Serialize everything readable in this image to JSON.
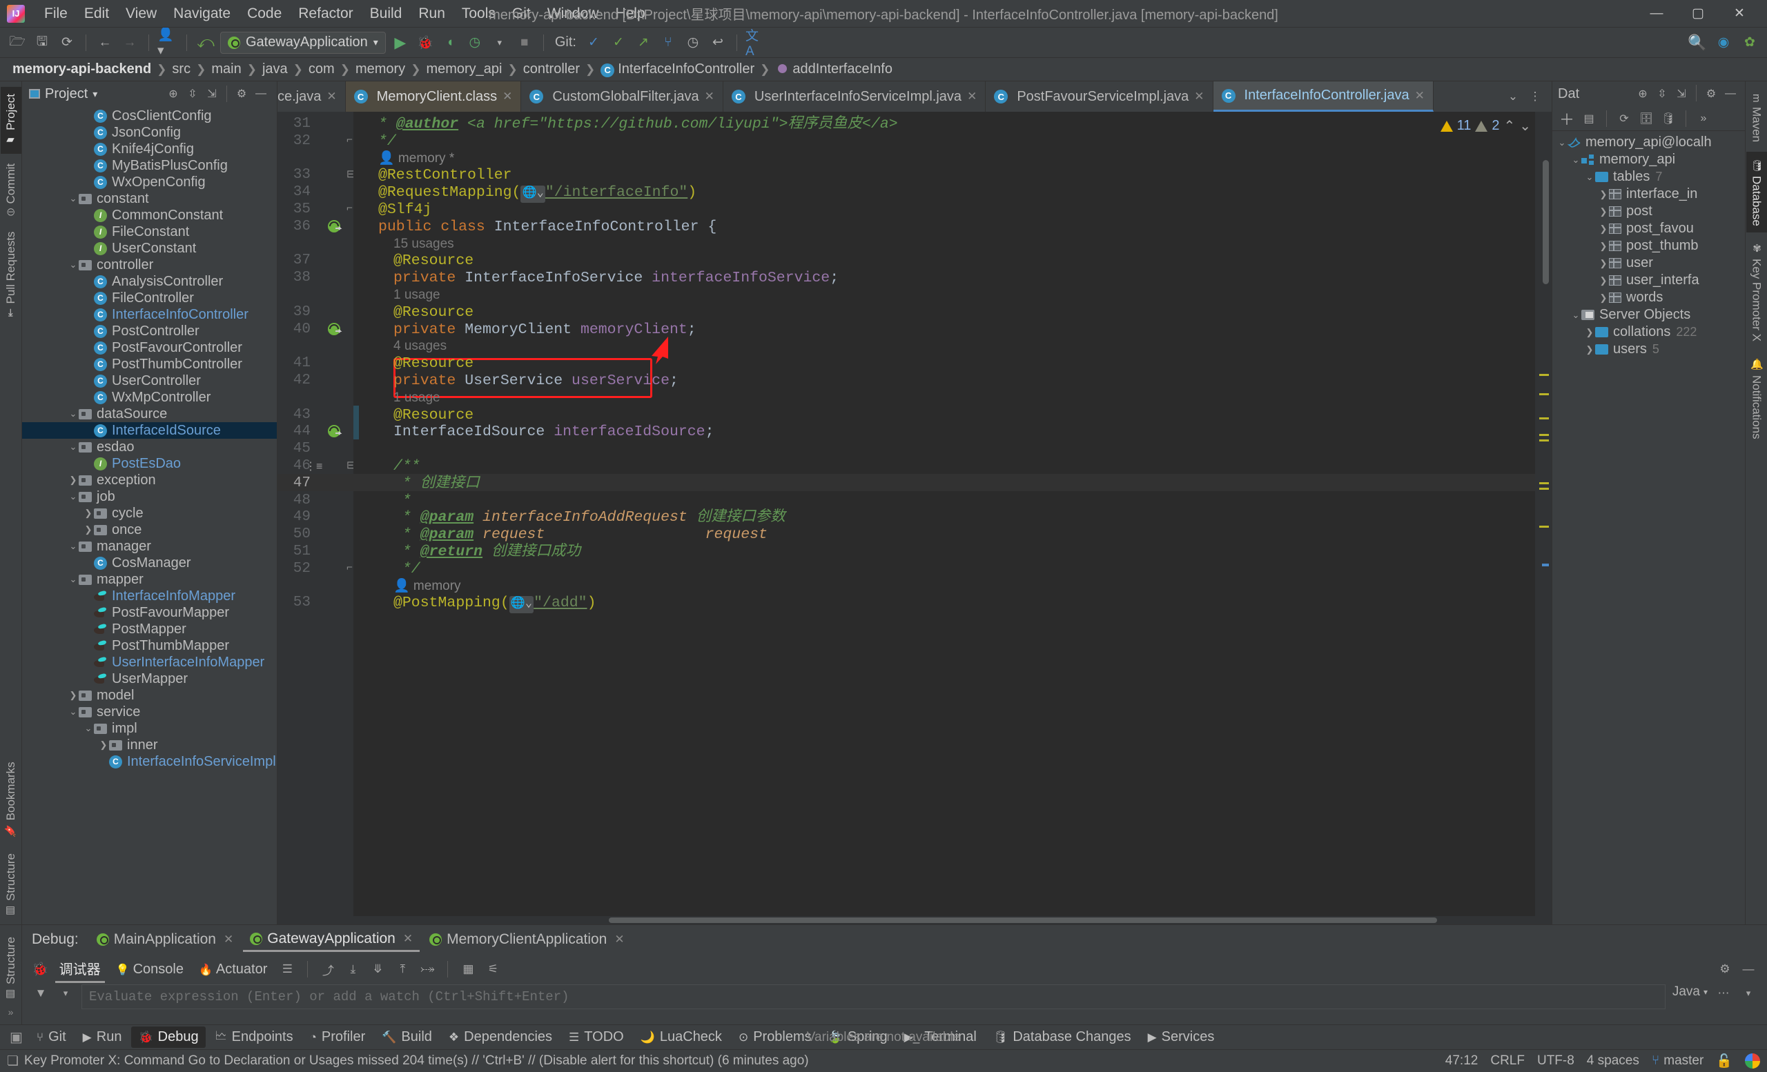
{
  "window": {
    "title": "memory-api-backend [D:\\Project\\星球项目\\memory-api\\memory-api-backend] - InterfaceInfoController.java [memory-api-backend]",
    "minimize": "—",
    "maximize": "▢",
    "close": "✕"
  },
  "menu": [
    "File",
    "Edit",
    "View",
    "Navigate",
    "Code",
    "Refactor",
    "Build",
    "Run",
    "Tools",
    "Git",
    "Window",
    "Help"
  ],
  "toolbar": {
    "run_config": "GatewayApplication",
    "git_label": "Git:",
    "icons": [
      "open-folder",
      "save",
      "sync",
      "back",
      "forward",
      "profile",
      "update",
      "run",
      "debug",
      "run-coverage",
      "profiler",
      "stop"
    ]
  },
  "breadcrumb": [
    {
      "label": "memory-api-backend",
      "bold": true,
      "icon": ""
    },
    {
      "label": "src",
      "bold": false,
      "icon": ""
    },
    {
      "label": "main",
      "bold": false,
      "icon": ""
    },
    {
      "label": "java",
      "bold": false,
      "icon": ""
    },
    {
      "label": "com",
      "bold": false,
      "icon": ""
    },
    {
      "label": "memory",
      "bold": false,
      "icon": ""
    },
    {
      "label": "memory_api",
      "bold": false,
      "icon": ""
    },
    {
      "label": "controller",
      "bold": false,
      "icon": ""
    },
    {
      "label": "InterfaceInfoController",
      "bold": false,
      "icon": "class"
    },
    {
      "label": "addInterfaceInfo",
      "bold": false,
      "icon": "method"
    }
  ],
  "left_tool_tabs": [
    {
      "label": "Project",
      "selected": true
    },
    {
      "label": "Commit",
      "selected": false
    },
    {
      "label": "Pull Requests",
      "selected": false
    },
    {
      "label": "Bookmarks",
      "selected": false
    },
    {
      "label": "Structure",
      "selected": false
    }
  ],
  "right_tool_tabs": [
    {
      "label": "Maven",
      "selected": false
    },
    {
      "label": "Database",
      "selected": true
    },
    {
      "label": "Key Promoter X",
      "selected": false
    },
    {
      "label": "Notifications",
      "selected": false
    }
  ],
  "project_panel": {
    "title": "Project",
    "tree": [
      {
        "indent": 4,
        "arrow": "",
        "icon": "class",
        "label": "CosClientConfig",
        "color": "normal"
      },
      {
        "indent": 4,
        "arrow": "",
        "icon": "class",
        "label": "JsonConfig",
        "color": "normal"
      },
      {
        "indent": 4,
        "arrow": "",
        "icon": "class",
        "label": "Knife4jConfig",
        "color": "normal"
      },
      {
        "indent": 4,
        "arrow": "",
        "icon": "class",
        "label": "MyBatisPlusConfig",
        "color": "normal"
      },
      {
        "indent": 4,
        "arrow": "",
        "icon": "class",
        "label": "WxOpenConfig",
        "color": "normal"
      },
      {
        "indent": 3,
        "arrow": "v",
        "icon": "folder",
        "label": "constant",
        "color": "normal"
      },
      {
        "indent": 4,
        "arrow": "",
        "icon": "interface",
        "label": "CommonConstant",
        "color": "normal"
      },
      {
        "indent": 4,
        "arrow": "",
        "icon": "interface",
        "label": "FileConstant",
        "color": "normal"
      },
      {
        "indent": 4,
        "arrow": "",
        "icon": "interface",
        "label": "UserConstant",
        "color": "normal"
      },
      {
        "indent": 3,
        "arrow": "v",
        "icon": "folder",
        "label": "controller",
        "color": "normal"
      },
      {
        "indent": 4,
        "arrow": "",
        "icon": "class",
        "label": "AnalysisController",
        "color": "normal"
      },
      {
        "indent": 4,
        "arrow": "",
        "icon": "class",
        "label": "FileController",
        "color": "normal"
      },
      {
        "indent": 4,
        "arrow": "",
        "icon": "class",
        "label": "InterfaceInfoController",
        "color": "blue"
      },
      {
        "indent": 4,
        "arrow": "",
        "icon": "class",
        "label": "PostController",
        "color": "normal"
      },
      {
        "indent": 4,
        "arrow": "",
        "icon": "class",
        "label": "PostFavourController",
        "color": "normal"
      },
      {
        "indent": 4,
        "arrow": "",
        "icon": "class",
        "label": "PostThumbController",
        "color": "normal"
      },
      {
        "indent": 4,
        "arrow": "",
        "icon": "class",
        "label": "UserController",
        "color": "normal"
      },
      {
        "indent": 4,
        "arrow": "",
        "icon": "class",
        "label": "WxMpController",
        "color": "normal"
      },
      {
        "indent": 3,
        "arrow": "v",
        "icon": "folder",
        "label": "dataSource",
        "color": "normal"
      },
      {
        "indent": 4,
        "arrow": "",
        "icon": "class",
        "label": "InterfaceIdSource",
        "color": "blue",
        "selected": true
      },
      {
        "indent": 3,
        "arrow": "v",
        "icon": "folder",
        "label": "esdao",
        "color": "normal"
      },
      {
        "indent": 4,
        "arrow": "",
        "icon": "interface",
        "label": "PostEsDao",
        "color": "blue"
      },
      {
        "indent": 3,
        "arrow": ">",
        "icon": "folder",
        "label": "exception",
        "color": "normal"
      },
      {
        "indent": 3,
        "arrow": "v",
        "icon": "folder",
        "label": "job",
        "color": "normal"
      },
      {
        "indent": 4,
        "arrow": ">",
        "icon": "folder",
        "label": "cycle",
        "color": "normal"
      },
      {
        "indent": 4,
        "arrow": ">",
        "icon": "folder",
        "label": "once",
        "color": "normal"
      },
      {
        "indent": 3,
        "arrow": "v",
        "icon": "folder",
        "label": "manager",
        "color": "normal"
      },
      {
        "indent": 4,
        "arrow": "",
        "icon": "class",
        "label": "CosManager",
        "color": "normal"
      },
      {
        "indent": 3,
        "arrow": "v",
        "icon": "folder",
        "label": "mapper",
        "color": "normal"
      },
      {
        "indent": 4,
        "arrow": "",
        "icon": "mybatis",
        "label": "InterfaceInfoMapper",
        "color": "blue"
      },
      {
        "indent": 4,
        "arrow": "",
        "icon": "mybatis",
        "label": "PostFavourMapper",
        "color": "normal"
      },
      {
        "indent": 4,
        "arrow": "",
        "icon": "mybatis",
        "label": "PostMapper",
        "color": "normal"
      },
      {
        "indent": 4,
        "arrow": "",
        "icon": "mybatis",
        "label": "PostThumbMapper",
        "color": "normal"
      },
      {
        "indent": 4,
        "arrow": "",
        "icon": "mybatis",
        "label": "UserInterfaceInfoMapper",
        "color": "blue"
      },
      {
        "indent": 4,
        "arrow": "",
        "icon": "mybatis",
        "label": "UserMapper",
        "color": "normal"
      },
      {
        "indent": 3,
        "arrow": ">",
        "icon": "folder",
        "label": "model",
        "color": "normal"
      },
      {
        "indent": 3,
        "arrow": "v",
        "icon": "folder",
        "label": "service",
        "color": "normal"
      },
      {
        "indent": 4,
        "arrow": "v",
        "icon": "folder",
        "label": "impl",
        "color": "normal"
      },
      {
        "indent": 5,
        "arrow": ">",
        "icon": "folder",
        "label": "inner",
        "color": "normal"
      },
      {
        "indent": 5,
        "arrow": "",
        "icon": "class",
        "label": "InterfaceInfoServiceImpl",
        "color": "blue"
      }
    ]
  },
  "editor_tabs": [
    {
      "label": "ce.java",
      "state": "partial",
      "icon": "none"
    },
    {
      "label": "MemoryClient.class",
      "state": "active",
      "icon": "class"
    },
    {
      "label": "CustomGlobalFilter.java",
      "state": "normal",
      "icon": "class"
    },
    {
      "label": "UserInterfaceInfoServiceImpl.java",
      "state": "normal",
      "icon": "class"
    },
    {
      "label": "PostFavourServiceImpl.java",
      "state": "normal",
      "icon": "class"
    },
    {
      "label": "InterfaceInfoController.java",
      "state": "current",
      "icon": "class"
    }
  ],
  "inspection": {
    "warning_count": "11",
    "weak_count": "2"
  },
  "code": {
    "lines": [
      {
        "num": "31",
        "indent": 1,
        "html": "<span class='cmt'>* </span><span class='doctag'>@author</span><span class='cmt'> &lt;a href=\"https://github.com/liyupi\"&gt;程序员鱼皮&lt;/a&gt;</span>"
      },
      {
        "num": "32",
        "indent": 1,
        "html": "<span class='cmt'>*/</span>",
        "fold": "end"
      },
      {
        "num": "",
        "indent": 1,
        "html": "<span class='memhint'>&#128100; memory *</span>",
        "hint": true
      },
      {
        "num": "33",
        "indent": 1,
        "html": "<span class='ann'>@RestController</span>",
        "fold": "start"
      },
      {
        "num": "34",
        "indent": 1,
        "html": "<span class='ann'>@RequestMapping(</span><span class='globe'></span><span class='linkstr'>\"/interfaceInfo\"</span><span class='ann'>)</span>"
      },
      {
        "num": "35",
        "indent": 1,
        "html": "<span class='ann'>@Slf4j</span>",
        "fold": "end"
      },
      {
        "num": "36",
        "indent": 1,
        "html": "<span class='kw'>public class </span><span class='typ'>InterfaceInfoController</span><span class='typ'> {</span>",
        "gutter": "spring"
      },
      {
        "num": "",
        "indent": 2,
        "html": "<span class='usage'>15 usages</span>",
        "hint": true
      },
      {
        "num": "37",
        "indent": 2,
        "html": "<span class='ann'>@Resource</span>"
      },
      {
        "num": "38",
        "indent": 2,
        "html": "<span class='kw'>private </span><span class='typ'>InterfaceInfoService </span><span class='fld'>interfaceInfoService</span><span class='typ'>;</span>"
      },
      {
        "num": "",
        "indent": 2,
        "html": "<span class='usage'>1 usage</span>",
        "hint": true
      },
      {
        "num": "39",
        "indent": 2,
        "html": "<span class='ann'>@Resource</span>"
      },
      {
        "num": "40",
        "indent": 2,
        "html": "<span class='kw'>private </span><span class='typ'>MemoryClient </span><span class='fld'>memoryClient</span><span class='typ'>;</span>",
        "gutter": "bean"
      },
      {
        "num": "",
        "indent": 2,
        "html": "<span class='usage'>4 usages</span>",
        "hint": true
      },
      {
        "num": "41",
        "indent": 2,
        "html": "<span class='ann'>@Resource</span>"
      },
      {
        "num": "42",
        "indent": 2,
        "html": "<span class='kw'>private </span><span class='typ'>UserService </span><span class='fld'>userService</span><span class='typ'>;</span>"
      },
      {
        "num": "",
        "indent": 2,
        "html": "<span class='usage'>1 usage</span>",
        "hint": true
      },
      {
        "num": "43",
        "indent": 2,
        "html": "<span class='ann'>@Resource</span>"
      },
      {
        "num": "44",
        "indent": 2,
        "html": "<span class='typ'>InterfaceIdSource </span><span class='fld'>interfaceIdSource</span><span class='typ'>;</span>",
        "gutter": "bean"
      },
      {
        "num": "45",
        "indent": 2,
        "html": ""
      },
      {
        "num": "46",
        "indent": 2,
        "html": "<span class='cmt'>/**</span>",
        "fold": "start"
      },
      {
        "num": "47",
        "indent": 2,
        "html": "<span class='cmt'> * 创建接口</span>",
        "current": true
      },
      {
        "num": "48",
        "indent": 2,
        "html": "<span class='cmt'> *</span>"
      },
      {
        "num": "49",
        "indent": 2,
        "html": "<span class='cmt'> * </span><span class='doctag'>@param</span><span class='docparam'> interfaceInfoAddRequest </span><span class='cmt'>创建接口参数</span>"
      },
      {
        "num": "50",
        "indent": 2,
        "html": "<span class='cmt'> * </span><span class='doctag'>@param</span><span class='docparam'> request                  request</span>"
      },
      {
        "num": "51",
        "indent": 2,
        "html": "<span class='cmt'> * </span><span class='doctag'>@return</span><span class='cmt'> 创建接口成功</span>"
      },
      {
        "num": "52",
        "indent": 2,
        "html": "<span class='cmt'> */</span>",
        "fold": "end"
      },
      {
        "num": "",
        "indent": 2,
        "html": "<span class='memhint'>&#128100; memory</span>",
        "hint": true
      },
      {
        "num": "53",
        "indent": 2,
        "html": "<span class='ann'>@PostMapping(</span><span class='globe'></span><span class='linkstr'>\"/add\"</span><span class='ann'>)</span>"
      }
    ]
  },
  "database_panel": {
    "title": "Dat",
    "tree": [
      {
        "indent": 0,
        "arrow": "v",
        "icon": "dolphin",
        "label": "memory_api@localh",
        "count": ""
      },
      {
        "indent": 1,
        "arrow": "v",
        "icon": "schema",
        "label": "memory_api",
        "count": ""
      },
      {
        "indent": 2,
        "arrow": "v",
        "icon": "folderblue",
        "label": "tables",
        "count": "7"
      },
      {
        "indent": 3,
        "arrow": ">",
        "icon": "table",
        "label": "interface_in",
        "count": ""
      },
      {
        "indent": 3,
        "arrow": ">",
        "icon": "table",
        "label": "post",
        "count": ""
      },
      {
        "indent": 3,
        "arrow": ">",
        "icon": "table",
        "label": "post_favou",
        "count": ""
      },
      {
        "indent": 3,
        "arrow": ">",
        "icon": "table",
        "label": "post_thumb",
        "count": ""
      },
      {
        "indent": 3,
        "arrow": ">",
        "icon": "table",
        "label": "user",
        "count": ""
      },
      {
        "indent": 3,
        "arrow": ">",
        "icon": "table",
        "label": "user_interfa",
        "count": ""
      },
      {
        "indent": 3,
        "arrow": ">",
        "icon": "table",
        "label": "words",
        "count": ""
      },
      {
        "indent": 1,
        "arrow": "v",
        "icon": "srvobj",
        "label": "Server Objects",
        "count": ""
      },
      {
        "indent": 2,
        "arrow": ">",
        "icon": "folderblue",
        "label": "collations",
        "count": "222"
      },
      {
        "indent": 2,
        "arrow": ">",
        "icon": "folderblue",
        "label": "users",
        "count": "5"
      }
    ]
  },
  "debug_panel": {
    "label": "Debug:",
    "sessions": [
      {
        "label": "MainApplication",
        "selected": false
      },
      {
        "label": "GatewayApplication",
        "selected": true
      },
      {
        "label": "MemoryClientApplication",
        "selected": false
      }
    ],
    "subtabs": [
      {
        "label": "调试器",
        "selected": true
      },
      {
        "label": "Console",
        "selected": false
      },
      {
        "label": "Actuator",
        "selected": false
      }
    ],
    "eval_placeholder": "Evaluate expression (Enter) or add a watch (Ctrl+Shift+Enter)",
    "variables_note": "Variables are not available",
    "language_selector": "Java"
  },
  "tool_window_bar": [
    {
      "label": "Git",
      "selected": false,
      "icon": "git"
    },
    {
      "label": "Run",
      "selected": false,
      "icon": "play"
    },
    {
      "label": "Debug",
      "selected": true,
      "icon": "bug"
    },
    {
      "label": "Endpoints",
      "selected": false,
      "icon": "endpoints"
    },
    {
      "label": "Profiler",
      "selected": false,
      "icon": "profiler"
    },
    {
      "label": "Build",
      "selected": false,
      "icon": "hammer"
    },
    {
      "label": "Dependencies",
      "selected": false,
      "icon": "deps"
    },
    {
      "label": "TODO",
      "selected": false,
      "icon": "todo"
    },
    {
      "label": "LuaCheck",
      "selected": false,
      "icon": "lua"
    },
    {
      "label": "Problems",
      "selected": false,
      "icon": "problems"
    },
    {
      "label": "Spring",
      "selected": false,
      "icon": "spring"
    },
    {
      "label": "Terminal",
      "selected": false,
      "icon": "terminal"
    },
    {
      "label": "Database Changes",
      "selected": false,
      "icon": "dbchanges"
    },
    {
      "label": "Services",
      "selected": false,
      "icon": "services"
    }
  ],
  "status_bar": {
    "message": "Key Promoter X: Command Go to Declaration or Usages missed 204 time(s) // 'Ctrl+B' // (Disable alert for this shortcut) (6 minutes ago)",
    "caret": "47:12",
    "line_sep": "CRLF",
    "encoding": "UTF-8",
    "indent": "4 spaces",
    "branch": "master"
  },
  "colors": {
    "accent": "#3592c4",
    "annotation": "#bbb529",
    "keyword": "#cc7832",
    "comment": "#629755",
    "field": "#9876aa",
    "highlight_box": "#ff1f1f",
    "editor_bg": "#2b2b2b",
    "panel_bg": "#3c3f41"
  }
}
